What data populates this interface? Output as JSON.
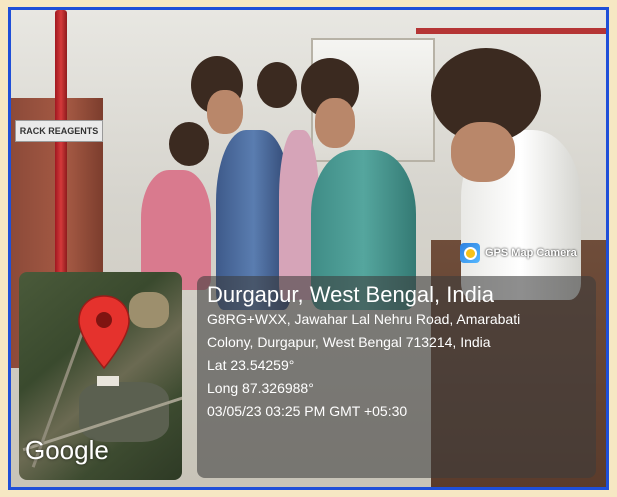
{
  "photo": {
    "sign_text": "RACK REAGENTS",
    "description_icon": "lab-photo"
  },
  "overlay": {
    "app_name": "GPS Map Camera",
    "location_title": "Durgapur, West Bengal, India",
    "address_line1": "G8RG+WXX, Jawahar Lal Nehru Road, Amarabati",
    "address_line2": "Colony, Durgapur, West Bengal 713214, India",
    "lat": "Lat 23.54259°",
    "long": "Long 87.326988°",
    "datetime": "03/05/23 03:25 PM GMT +05:30",
    "map_brand": "Google"
  },
  "colors": {
    "frame_border": "#1f4fd8",
    "page_background": "#f6e7c3",
    "pin_red": "#e5322d"
  }
}
